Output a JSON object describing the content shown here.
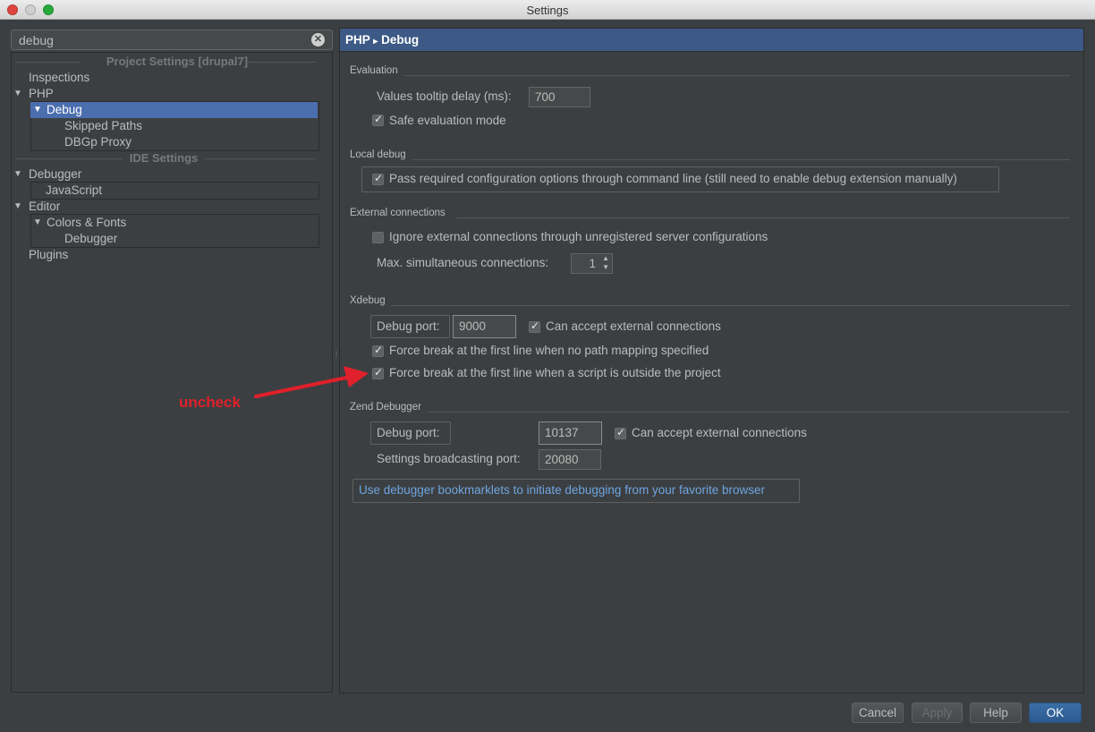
{
  "window": {
    "title": "Settings"
  },
  "search": {
    "value": "debug"
  },
  "tree": {
    "project_header": "Project Settings [drupal7]",
    "ide_header": "IDE Settings",
    "items": {
      "inspections": "Inspections",
      "php": "PHP",
      "debug": "Debug",
      "skipped_paths": "Skipped Paths",
      "dbgp_proxy": "DBGp Proxy",
      "debugger": "Debugger",
      "javascript": "JavaScript",
      "editor": "Editor",
      "colors_fonts": "Colors & Fonts",
      "editor_debugger": "Debugger",
      "plugins": "Plugins"
    }
  },
  "header": {
    "breadcrumb_parent": "PHP",
    "breadcrumb_sep": "▸",
    "breadcrumb_current": "Debug"
  },
  "evaluation": {
    "title": "Evaluation",
    "tooltip_delay_label": "Values tooltip delay (ms):",
    "tooltip_delay_value": "700",
    "safe_mode_label": "Safe evaluation mode",
    "safe_mode_checked": true
  },
  "local_debug": {
    "title": "Local debug",
    "pass_options_label": "Pass required configuration options through command line (still need to enable debug extension manually)",
    "pass_options_checked": true
  },
  "external": {
    "title": "External connections",
    "ignore_label": "Ignore external connections through unregistered server configurations",
    "ignore_checked": false,
    "max_label": "Max. simultaneous connections:",
    "max_value": "1"
  },
  "xdebug": {
    "title": "Xdebug",
    "port_label": "Debug port:",
    "port_value": "9000",
    "accept_label": "Can accept external connections",
    "accept_checked": true,
    "force_no_mapping_label": "Force break at the first line when no path mapping specified",
    "force_no_mapping_checked": true,
    "force_outside_label": "Force break at the first line when a script is outside the project",
    "force_outside_checked": true
  },
  "annotation": {
    "text": "uncheck",
    "color": "#e0202a"
  },
  "zend": {
    "title": "Zend Debugger",
    "port_label": "Debug port:",
    "port_value": "10137",
    "accept_label": "Can accept external connections",
    "accept_checked": true,
    "broadcast_label": "Settings broadcasting port:",
    "broadcast_value": "20080"
  },
  "bookmarklets_link": "Use debugger bookmarklets to initiate debugging from your favorite browser",
  "buttons": {
    "cancel": "Cancel",
    "apply": "Apply",
    "help": "Help",
    "ok": "OK"
  },
  "colors": {
    "background": "#3c3f41",
    "selection": "#4b6eaf",
    "header": "#3d5a86",
    "link": "#6ea5e0"
  }
}
